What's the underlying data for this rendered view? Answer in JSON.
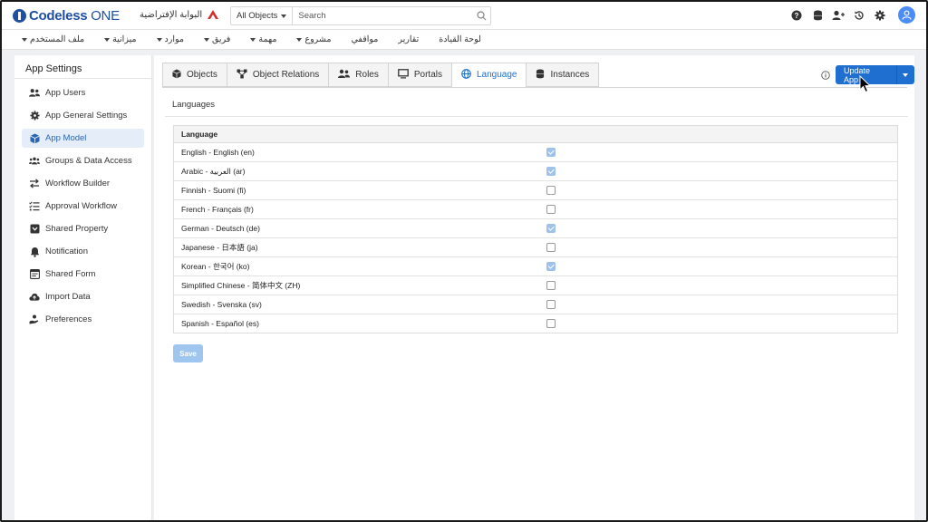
{
  "header": {
    "logo_text": "Codeless",
    "logo_suffix": "ONE",
    "portal_name": "البوابة الإفتراضية",
    "search": {
      "scope": "All Objects",
      "placeholder": "Search"
    },
    "icons": [
      "help-icon",
      "database-icon",
      "add-user-icon",
      "history-icon",
      "settings-icon",
      "user-avatar-icon"
    ]
  },
  "menu": {
    "items": [
      {
        "label": "لوحة القيادة",
        "dropdown": false
      },
      {
        "label": "تقارير",
        "dropdown": false
      },
      {
        "label": "مواقفي",
        "dropdown": false
      },
      {
        "label": "مشروع",
        "dropdown": true
      },
      {
        "label": "مهمة",
        "dropdown": true
      },
      {
        "label": "فريق",
        "dropdown": true
      },
      {
        "label": "موارد",
        "dropdown": true
      },
      {
        "label": "ميزانية",
        "dropdown": true
      },
      {
        "label": "ملف المستخدم",
        "dropdown": true
      }
    ]
  },
  "sidebar": {
    "title": "App Settings",
    "items": [
      {
        "label": "App Users",
        "icon": "users-icon",
        "active": false
      },
      {
        "label": "App General Settings",
        "icon": "gear-icon",
        "active": false
      },
      {
        "label": "App Model",
        "icon": "cube-icon",
        "active": true
      },
      {
        "label": "Groups & Data Access",
        "icon": "group-icon",
        "active": false
      },
      {
        "label": "Workflow Builder",
        "icon": "arrows-icon",
        "active": false
      },
      {
        "label": "Approval Workflow",
        "icon": "checklist-icon",
        "active": false
      },
      {
        "label": "Shared Property",
        "icon": "shared-property-icon",
        "active": false
      },
      {
        "label": "Notification",
        "icon": "bell-icon",
        "active": false
      },
      {
        "label": "Shared Form",
        "icon": "form-icon",
        "active": false
      },
      {
        "label": "Import Data",
        "icon": "cloud-upload-icon",
        "active": false
      },
      {
        "label": "Preferences",
        "icon": "preferences-icon",
        "active": false
      }
    ]
  },
  "tabs": [
    {
      "label": "Objects",
      "icon": "cube-icon",
      "active": false
    },
    {
      "label": "Object Relations",
      "icon": "relations-icon",
      "active": false
    },
    {
      "label": "Roles",
      "icon": "roles-icon",
      "active": false
    },
    {
      "label": "Portals",
      "icon": "monitor-icon",
      "active": false
    },
    {
      "label": "Language",
      "icon": "globe-icon",
      "active": true
    },
    {
      "label": "Instances",
      "icon": "database-icon",
      "active": false
    }
  ],
  "update_button": {
    "label": "Update App"
  },
  "section": {
    "title": "Languages"
  },
  "table": {
    "header": "Language",
    "rows": [
      {
        "name": "English - English (en)",
        "enabled": true
      },
      {
        "name": "Arabic - العربية (ar)",
        "enabled": true
      },
      {
        "name": "Finnish - Suomi (fi)",
        "enabled": false
      },
      {
        "name": "French - Français (fr)",
        "enabled": false
      },
      {
        "name": "German - Deutsch (de)",
        "enabled": true
      },
      {
        "name": "Japanese - 日本語 (ja)",
        "enabled": false
      },
      {
        "name": "Korean - 한국어 (ko)",
        "enabled": true
      },
      {
        "name": "Simplified Chinese - 简体中文 (ZH)",
        "enabled": false
      },
      {
        "name": "Swedish - Svenska (sv)",
        "enabled": false
      },
      {
        "name": "Spanish - Español (es)",
        "enabled": false
      }
    ]
  },
  "save_button": {
    "label": "Save"
  },
  "colors": {
    "primary": "#1f6fd1",
    "active_bg": "#e5edf8",
    "checked": "#9ec2ea",
    "logo": "#1f4fa3",
    "portal_mark": "#d0312d"
  }
}
